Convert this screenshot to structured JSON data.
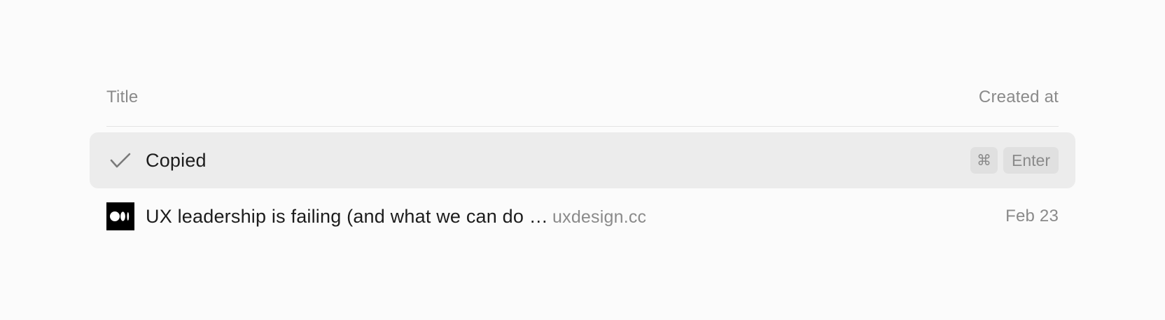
{
  "header": {
    "title_label": "Title",
    "created_label": "Created at"
  },
  "rows": [
    {
      "title": "Copied",
      "icon": "check-icon",
      "selected": true,
      "shortcut": {
        "modifier": "⌘",
        "key": "Enter"
      }
    },
    {
      "title": "UX leadership is failing (and what we can do …",
      "domain": "uxdesign.cc",
      "icon": "medium-logo-icon",
      "date": "Feb 23"
    }
  ],
  "colors": {
    "background": "#fbfbfb",
    "selected_row": "#ececec",
    "muted_text": "#8a8a8a",
    "primary_text": "#1c1c1c",
    "kbd_background": "#e0e0e0"
  }
}
